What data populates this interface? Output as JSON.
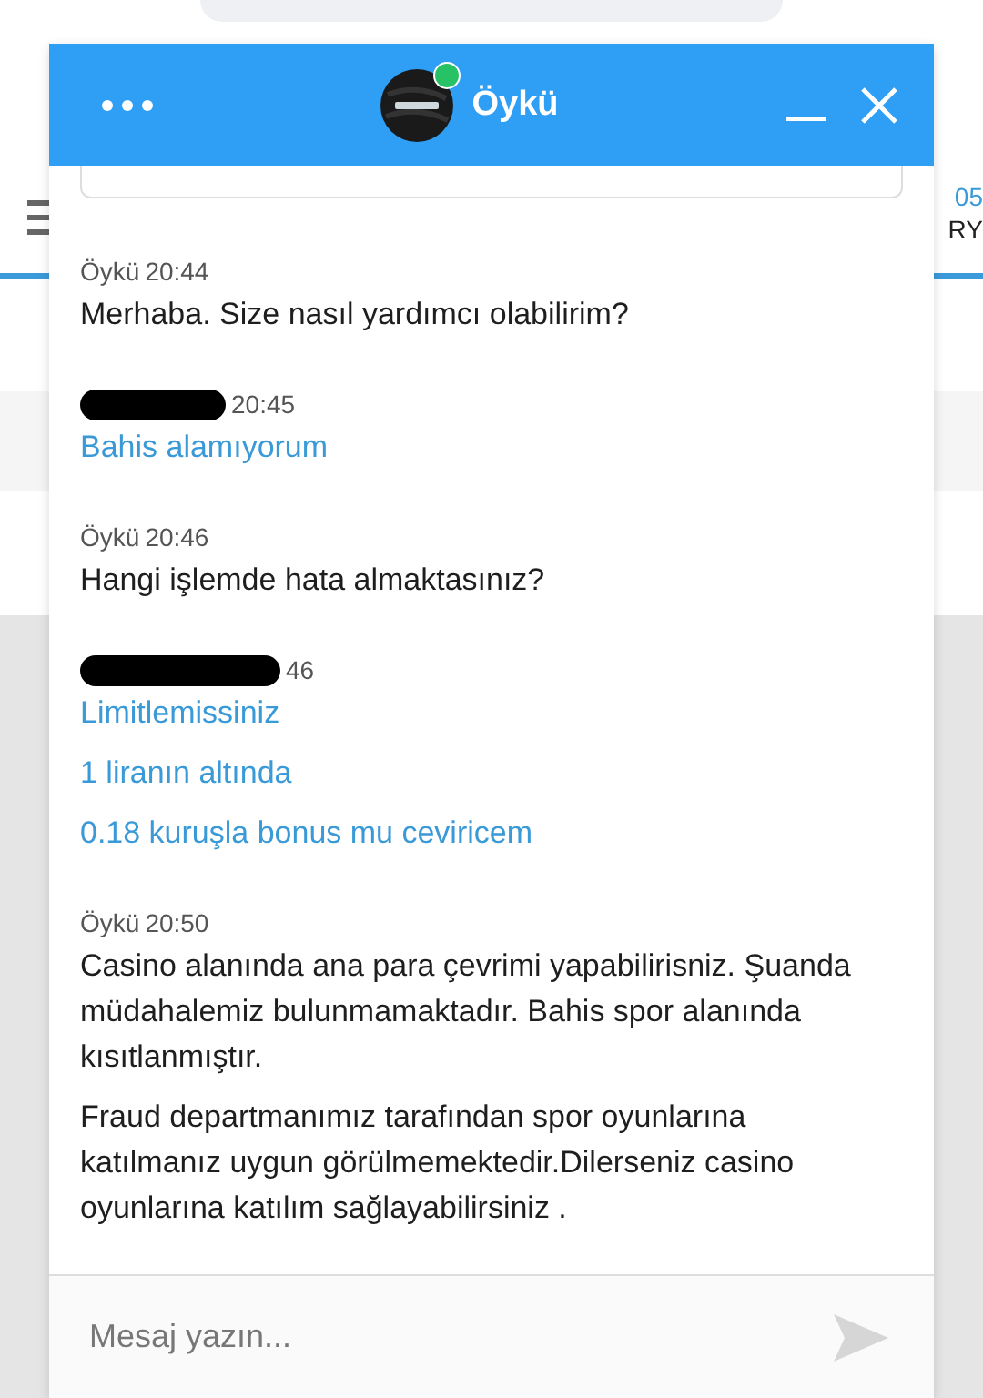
{
  "background": {
    "right_edge_texts": [
      "05",
      "RY"
    ]
  },
  "chat": {
    "title": "Öykü",
    "online": true,
    "input": {
      "placeholder": "Mesaj yazın..."
    },
    "messages": [
      {
        "kind": "agent",
        "sender": "Öykü",
        "time": "20:44",
        "paragraphs": [
          "Merhaba. Size nasıl yardımcı olabilirim?"
        ]
      },
      {
        "kind": "visitor",
        "redacted": true,
        "time": "20:45",
        "paragraphs": [
          "Bahis alamıyorum"
        ]
      },
      {
        "kind": "agent",
        "sender": "Öykü",
        "time": "20:46",
        "paragraphs": [
          "Hangi işlemde hata almaktasınız?"
        ]
      },
      {
        "kind": "visitor",
        "redacted": true,
        "time": "46",
        "paragraphs": [
          "Limitlemissiniz",
          "1 liranın altında",
          "0.18 kuruşla bonus mu ceviricem"
        ]
      },
      {
        "kind": "agent",
        "sender": "Öykü",
        "time": "20:50",
        "paragraphs": [
          "Casino alanında ana para çevrimi yapabilirisniz. Şuanda müdahalemiz bulunmamaktadır. Bahis spor alanında kısıtlanmıştır.",
          "Fraud departmanımız tarafından spor oyunlarına katılmanız uygun görülmemektedir.Dilerseniz casino oyunlarına katılım sağlayabilirsiniz ."
        ]
      }
    ]
  }
}
